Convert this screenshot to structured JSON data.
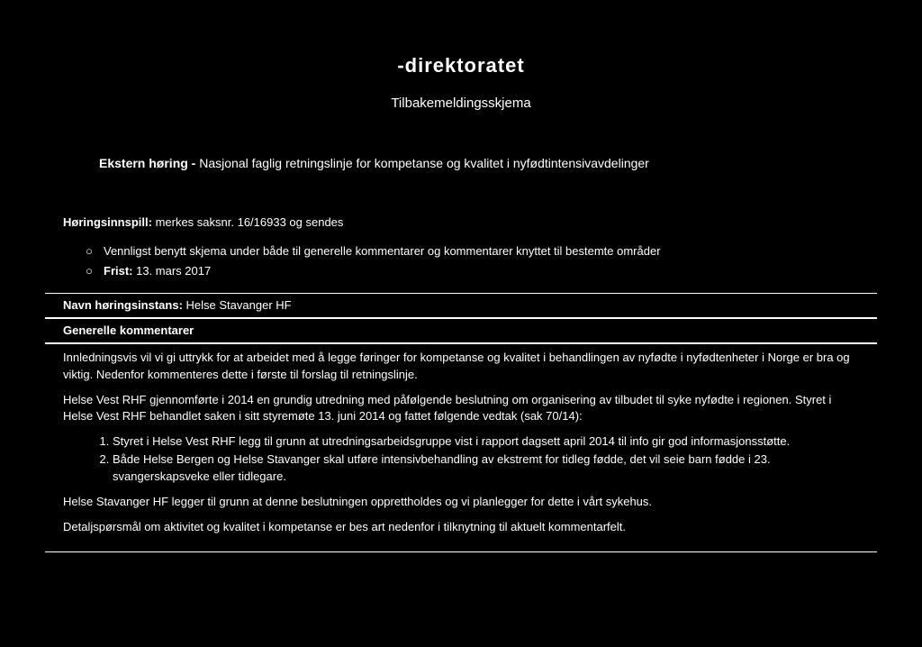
{
  "header": {
    "title": "-direktoratet",
    "subtitle": "Tilbakemeldingsskjema"
  },
  "hearing": {
    "prefix_bold": "Ekstern høring - ",
    "rest": "Nasjonal faglig retningslinje for kompetanse og kvalitet i nyfødtintensivavdelinger"
  },
  "horingsinnspill": {
    "label": "Høringsinnspill:",
    "text": " merkes saksnr. 16/16933 og sendes"
  },
  "bullets": {
    "item1": "Vennligst benytt skjema under både til generelle kommentarer og kommentarer knyttet til bestemte områder",
    "item2_label": "Frist:",
    "item2_value": " 13. mars 2017"
  },
  "navn": {
    "label": "Navn høringsinstans:",
    "value": " Helse Stavanger HF"
  },
  "generelle": {
    "heading": "Generelle kommentarer",
    "para1": "Innledningsvis vil vi gi uttrykk for at arbeidet med å legge føringer for kompetanse og kvalitet i behandlingen av nyfødte i nyfødtenheter i Norge er bra og viktig. Nedenfor kommenteres dette i første til forslag til retningslinje.",
    "para2": "Helse Vest RHF gjennomførte i 2014 en grundig utredning med påfølgende beslutning om organisering av tilbudet til syke nyfødte i regionen. Styret i Helse Vest RHF behandlet saken i sitt styremøte 13. juni 2014 og fattet følgende vedtak (sak 70/14):",
    "num1": "Styret i Helse Vest RHF legg til grunn at utredningsarbeidsgruppe vist i rapport dagsett april 2014 til info gir god informasjonsstøtte.",
    "num2": "Både Helse Bergen og Helse Stavanger skal utføre intensivbehandling av ekstremt for tidleg fødde, det vil seie barn fødde i 23. svangerskapsveke eller tidlegare.",
    "para3": "Helse Stavanger HF legger til grunn at denne beslutningen opprettholdes og vi planlegger for dette i vårt sykehus.",
    "para4": "Detaljspørsmål om aktivitet og kvalitet i kompetanse er bes art nedenfor i tilknytning til aktuelt kommentarfelt."
  }
}
